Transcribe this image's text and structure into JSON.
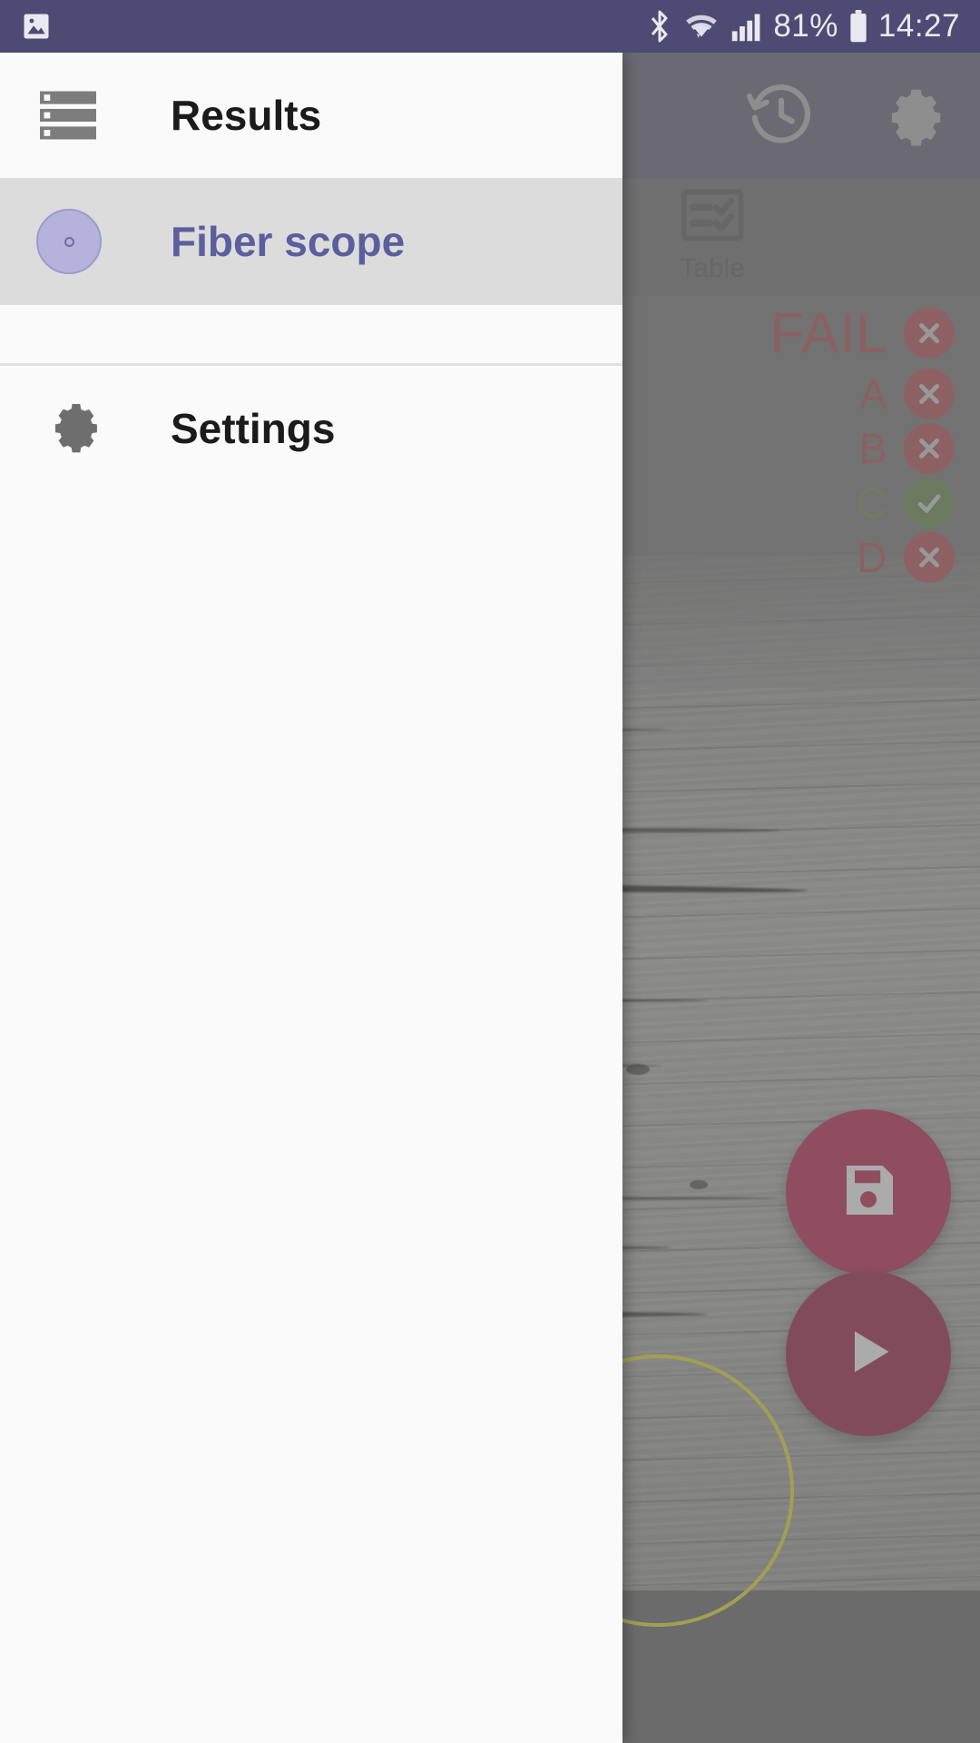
{
  "status_bar": {
    "left_icon": "image-icon",
    "bluetooth_icon": "bluetooth-icon",
    "wifi_icon": "wifi-icon",
    "signal_icon": "signal-bars-icon",
    "battery_percent": "81%",
    "battery_icon": "battery-icon",
    "time": "14:27"
  },
  "app_bar": {
    "history_icon": "history-icon",
    "settings_icon": "gear-icon"
  },
  "tabs": [
    {
      "label": "Table",
      "icon": "table-checklist-icon",
      "selected": true
    }
  ],
  "results": {
    "overall": {
      "label": "FAIL",
      "status": "fail",
      "badge": "x-circle-icon"
    },
    "rows": [
      {
        "label": "A",
        "status": "fail",
        "badge": "x-circle-icon"
      },
      {
        "label": "B",
        "status": "fail",
        "badge": "x-circle-icon"
      },
      {
        "label": "C",
        "status": "pass",
        "badge": "check-circle-icon"
      },
      {
        "label": "D",
        "status": "fail",
        "badge": "x-circle-icon"
      }
    ]
  },
  "fabs": {
    "save": {
      "label": "Save",
      "icon": "floppy-disk-icon"
    },
    "play": {
      "label": "Play",
      "icon": "play-triangle-icon"
    }
  },
  "drawer": {
    "items": [
      {
        "id": "results",
        "label": "Results",
        "icon": "list-icon",
        "selected": false
      },
      {
        "id": "fiberscope",
        "label": "Fiber scope",
        "icon": "fiber-dot-icon",
        "selected": true
      },
      {
        "id": "settings",
        "label": "Settings",
        "icon": "gear-icon",
        "selected": false
      }
    ]
  },
  "colors": {
    "status_bar": "#4d4b74",
    "app_bar": "#3c3a5e",
    "accent_purple": "#5c5f9e",
    "fail_red": "#c7141e",
    "pass_green": "#3f7a0c",
    "fab_crimson": "#aa1943",
    "drawer_bg": "#fafafa",
    "drawer_selected": "#dcdcdc"
  }
}
